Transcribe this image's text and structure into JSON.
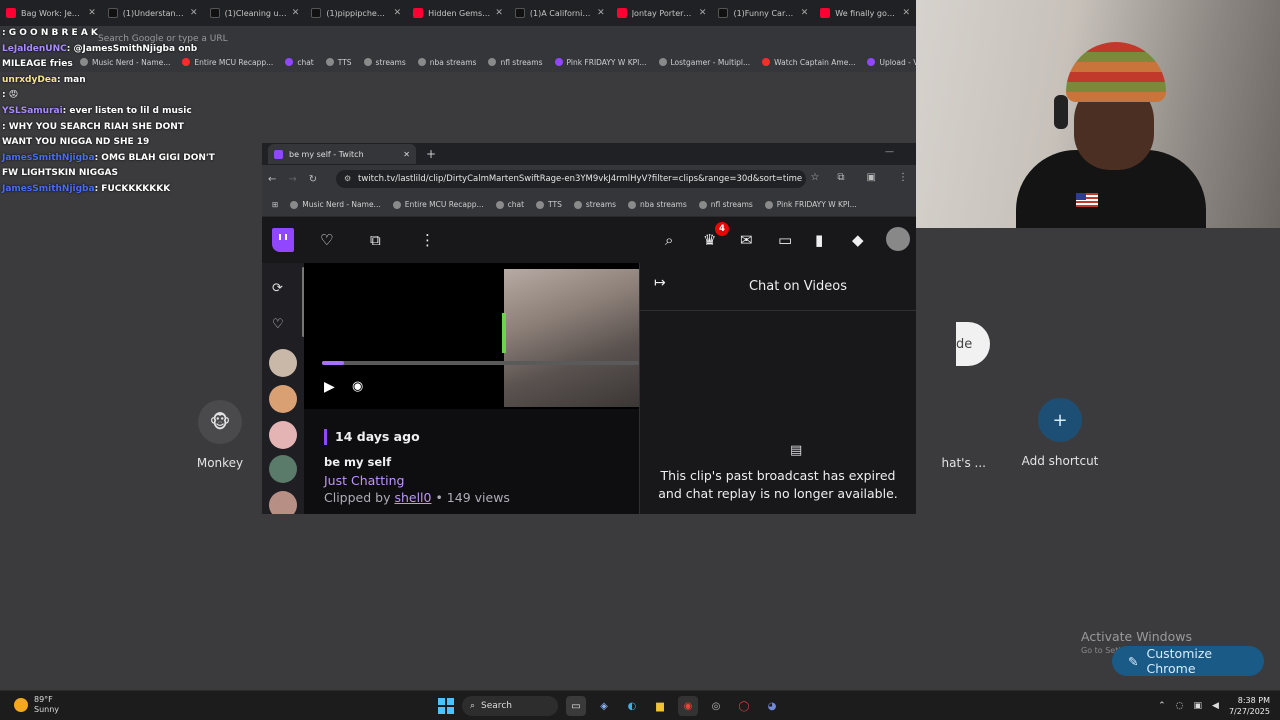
{
  "bg_tabs": [
    {
      "label": "Bag Work: Jeff Te",
      "type": "yt"
    },
    {
      "label": "(1)Understanding",
      "type": "tt"
    },
    {
      "label": "(1)Cleaning up af",
      "type": "tt"
    },
    {
      "label": "(1)pippipcheeriol",
      "type": "tt"
    },
    {
      "label": "Hidden Gems: Bri",
      "type": "yt"
    },
    {
      "label": "(1)A California m",
      "type": "tt"
    },
    {
      "label": "Jontay Porter | Sc",
      "type": "yt"
    },
    {
      "label": "(1)Funny Car Rec",
      "type": "tt"
    },
    {
      "label": "We finally got Me",
      "type": "yt"
    }
  ],
  "bg_address_placeholder": "Search Google or type a URL",
  "bookmarks": [
    {
      "label": "Music Nerd - Name...",
      "dot": "gray"
    },
    {
      "label": "Entire MCU Recapp...",
      "dot": "red"
    },
    {
      "label": "chat",
      "dot": "pur"
    },
    {
      "label": "TTS",
      "dot": "gray"
    },
    {
      "label": "streams",
      "dot": "gray"
    },
    {
      "label": "nba streams",
      "dot": "gray"
    },
    {
      "label": "nfl streams",
      "dot": "gray"
    },
    {
      "label": "Pink FRIDAYY W KPI...",
      "dot": "pur"
    },
    {
      "label": "Lostgamer - Multipl...",
      "dot": "gray"
    },
    {
      "label": "Watch Captain Ame...",
      "dot": "red"
    },
    {
      "label": "Upload - Vizard",
      "dot": "pur"
    },
    {
      "label": "Eklipse studio",
      "dot": "gray"
    }
  ],
  "chat_lines": [
    {
      "user": "",
      "ucls": "u-gray",
      "text": ": G O O N B R E A K"
    },
    {
      "user": "LeJaldenUNC",
      "ucls": "u-pur",
      "text": ": @JamesSmithNjigba onb"
    },
    {
      "user": "",
      "ucls": "u-gray",
      "text": "MILEAGE fries"
    },
    {
      "user": "unrxdyDea",
      "ucls": "u-yel",
      "text": ": man"
    },
    {
      "user": "",
      "ucls": "u-blue",
      "text": ": 😡"
    },
    {
      "user": "YSLSamurai",
      "ucls": "u-pur",
      "text": ": ever listen to lil d music"
    },
    {
      "user": "",
      "ucls": "u-gray",
      "text": ": WHY YOU SEARCH RIAH SHE DONT"
    },
    {
      "user": "",
      "ucls": "u-gray",
      "text": "WANT YOU NIGGA ND SHE 19"
    },
    {
      "user": "JamesSmithNjigba",
      "ucls": "u-blue",
      "text": ": OMG BLAH GIGI DON'T"
    },
    {
      "user": "",
      "ucls": "u-gray",
      "text": "FW LIGHTSKIN NIGGAS"
    },
    {
      "user": "JamesSmithNjigba",
      "ucls": "u-blue",
      "text": ": FUCKKKKKKK"
    }
  ],
  "window": {
    "tab_title": "be my self - Twitch",
    "url": "twitch.tv/lastlild/clip/DirtyCalmMartenSwiftRage-en3YM9vkJ4rmlHyV?filter=clips&range=30d&sort=time",
    "bookmarks": [
      "Music Nerd - Name...",
      "Entire MCU Recapp...",
      "chat",
      "TTS",
      "streams",
      "nba streams",
      "nfl streams",
      "Pink FRIDAYY W KPI..."
    ]
  },
  "twitch": {
    "notif_count": "4",
    "progress": 0.07,
    "clip": {
      "ago": "14 days ago",
      "title": "be my self",
      "game": "Just Chatting",
      "clipped_prefix": "Clipped by ",
      "clipper": "shell0",
      "views": " • 149 views"
    },
    "chat_panel": {
      "title": "Chat on Videos",
      "message": "This clip's past broadcast has expired and chat replay is no longer available."
    }
  },
  "shortcuts": {
    "monkey": "Monkey",
    "whats": "hat's ...",
    "add": "Add shortcut",
    "pill": "de"
  },
  "activate": {
    "title": "Activate Windows",
    "sub": "Go to Settings to activate Windows."
  },
  "customize_label": "Customize Chrome",
  "taskbar": {
    "temp": "89°F",
    "condition": "Sunny",
    "search": "Search",
    "time": "8:38 PM",
    "date": "7/27/2025"
  }
}
